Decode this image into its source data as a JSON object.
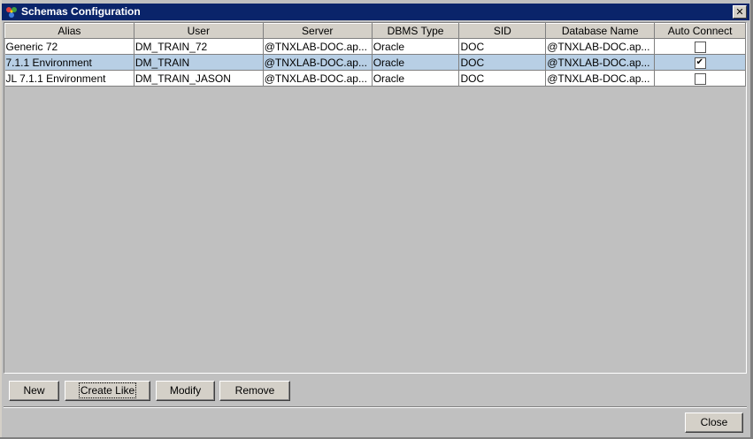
{
  "window": {
    "title": "Schemas Configuration",
    "close_glyph": "✕"
  },
  "table": {
    "columns": [
      "Alias",
      "User",
      "Server",
      "DBMS Type",
      "SID",
      "Database Name",
      "Auto Connect"
    ],
    "rows": [
      {
        "alias": "Generic 72",
        "user": "DM_TRAIN_72",
        "server": "@TNXLAB-DOC.ap...",
        "dbms_type": "Oracle",
        "sid": "DOC",
        "database_name": "@TNXLAB-DOC.ap...",
        "auto_connect": false,
        "selected": false
      },
      {
        "alias": "7.1.1 Environment",
        "user": "DM_TRAIN",
        "server": "@TNXLAB-DOC.ap...",
        "dbms_type": "Oracle",
        "sid": "DOC",
        "database_name": "@TNXLAB-DOC.ap...",
        "auto_connect": true,
        "selected": true
      },
      {
        "alias": "JL 7.1.1 Environment",
        "user": "DM_TRAIN_JASON",
        "server": "@TNXLAB-DOC.ap...",
        "dbms_type": "Oracle",
        "sid": "DOC",
        "database_name": "@TNXLAB-DOC.ap...",
        "auto_connect": false,
        "selected": false
      }
    ]
  },
  "buttons": {
    "new": "New",
    "create_like": "Create Like",
    "modify": "Modify",
    "remove": "Remove",
    "close": "Close"
  },
  "colors": {
    "title_bar": "#0a246a",
    "selected_row": "#b8cfe5",
    "dialog_bg": "#c0c0c0"
  },
  "icons": {
    "app": "schemas-app-icon",
    "close": "close-icon",
    "checkbox_checked": "checkmark-icon"
  }
}
